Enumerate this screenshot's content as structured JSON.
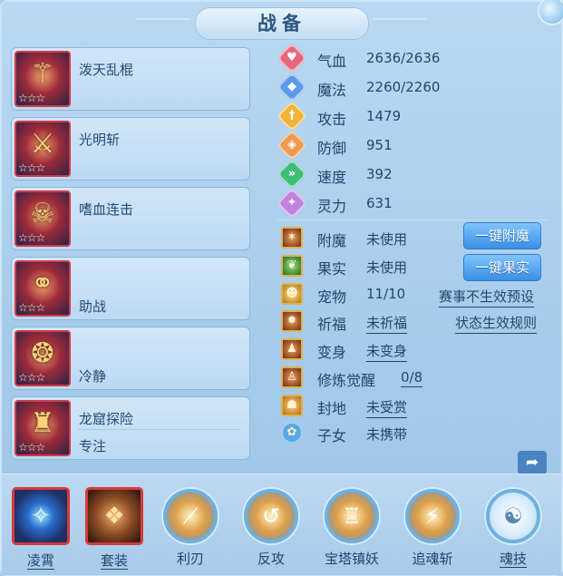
{
  "title": "战备",
  "cards": [
    {
      "name": "泼天乱棍",
      "name2": "",
      "stars": "☆☆☆",
      "icon": "staff-icon"
    },
    {
      "name": "光明斩",
      "name2": "",
      "stars": "☆☆☆",
      "icon": "armor-icon"
    },
    {
      "name": "嗜血连击",
      "name2": "",
      "stars": "☆☆☆",
      "icon": "mask-icon"
    },
    {
      "name": "",
      "name2": "助战",
      "stars": "☆☆☆",
      "icon": "chain-icon"
    },
    {
      "name": "",
      "name2": "冷静",
      "stars": "☆☆☆",
      "icon": "gem-belt-icon"
    },
    {
      "name": "龙窟探险",
      "name2": "专注",
      "stars": "☆☆☆",
      "icon": "dragon-robe-icon"
    }
  ],
  "stats": [
    {
      "label": "气血",
      "value": "2636/2636",
      "icon": "heart-icon",
      "color": "#e8677d"
    },
    {
      "label": "魔法",
      "value": "2260/2260",
      "icon": "mana-icon",
      "color": "#5a9ae8"
    },
    {
      "label": "攻击",
      "value": "1479",
      "icon": "sword-icon",
      "color": "#f2b33a"
    },
    {
      "label": "防御",
      "value": "951",
      "icon": "shield-icon",
      "color": "#ef9a54"
    },
    {
      "label": "速度",
      "value": "392",
      "icon": "speed-icon",
      "color": "#3fbe77"
    },
    {
      "label": "灵力",
      "value": "631",
      "icon": "spirit-icon",
      "color": "#c282e0"
    }
  ],
  "items": [
    {
      "label": "附魔",
      "value": "未使用",
      "underline": false,
      "icon": "enchant-icon"
    },
    {
      "label": "果实",
      "value": "未使用",
      "underline": false,
      "icon": "fruit-icon"
    },
    {
      "label": "宠物",
      "value": "11/10",
      "underline": false,
      "icon": "pet-icon"
    },
    {
      "label": "祈福",
      "value": "未祈福",
      "underline": true,
      "icon": "blessing-icon"
    },
    {
      "label": "变身",
      "value": "未变身",
      "underline": true,
      "icon": "transform-icon"
    },
    {
      "label": "修炼觉醒",
      "value": "0/8",
      "underline": true,
      "icon": "cultivation-icon"
    },
    {
      "label": "封地",
      "value": "未受赏",
      "underline": true,
      "icon": "fief-icon"
    },
    {
      "label": "子女",
      "value": "未携带",
      "underline": false,
      "icon": "paw-icon"
    }
  ],
  "buttons": {
    "enchant": "一键附魔",
    "fruit": "一键果实"
  },
  "links": {
    "preset": "赛事不生效预设",
    "rules": "状态生效规则"
  },
  "bottom": [
    {
      "label": "凌霄",
      "style": "square",
      "icon": "star-orb-icon",
      "underline": true
    },
    {
      "label": "套装",
      "style": "square-brown",
      "icon": "armor-set-icon",
      "underline": true
    },
    {
      "label": "利刃",
      "style": "ring",
      "icon": "blade-icon",
      "underline": false
    },
    {
      "label": "反攻",
      "style": "ring",
      "icon": "counter-icon",
      "underline": false
    },
    {
      "label": "宝塔镇妖",
      "style": "ring",
      "icon": "pagoda-icon",
      "underline": false
    },
    {
      "label": "追魂斩",
      "style": "ring",
      "icon": "chase-slash-icon",
      "underline": false
    },
    {
      "label": "魂技",
      "style": "ring-pale",
      "icon": "soul-skill-icon",
      "underline": true
    }
  ]
}
